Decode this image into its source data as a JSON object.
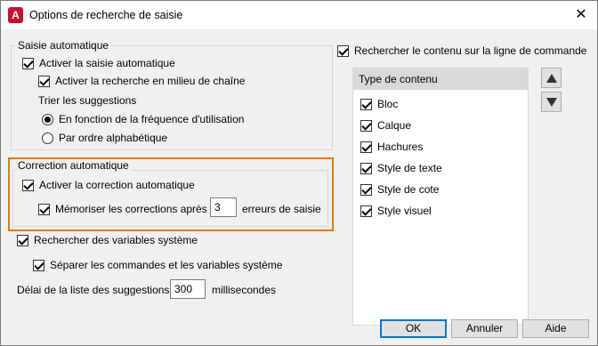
{
  "window": {
    "title": "Options de recherche de saisie",
    "app_icon_letter": "A",
    "close_glyph": "✕"
  },
  "autocomplete": {
    "group_title": "Saisie automatique",
    "enable_label": "Activer la saisie automatique",
    "enable_checked": true,
    "midstring_label": "Activer la recherche en milieu de chaîne",
    "midstring_checked": true,
    "sort_label": "Trier les suggestions",
    "sort_options": [
      {
        "label": "En fonction de la fréquence d'utilisation",
        "selected": true
      },
      {
        "label": "Par ordre alphabétique",
        "selected": false
      }
    ]
  },
  "autocorrect": {
    "group_title": "Correction automatique",
    "enable_label": "Activer la correction automatique",
    "enable_checked": true,
    "remember_label": "Mémoriser les corrections après",
    "remember_checked": true,
    "remember_value": "3",
    "remember_suffix": "erreurs de saisie",
    "highlight_color": "#e07b14"
  },
  "sysvars": {
    "search_label": "Rechercher des variables système",
    "search_checked": true,
    "separate_label": "Séparer les commandes et les variables système",
    "separate_checked": true
  },
  "delay": {
    "label": "Délai de la liste des suggestions",
    "value": "300",
    "suffix": "millisecondes"
  },
  "content_search": {
    "label": "Rechercher le contenu sur la ligne de commande",
    "checked": true,
    "list_header": "Type de contenu",
    "items": [
      {
        "label": "Bloc",
        "checked": true
      },
      {
        "label": "Calque",
        "checked": true
      },
      {
        "label": "Hachures",
        "checked": true
      },
      {
        "label": "Style de texte",
        "checked": true
      },
      {
        "label": "Style de cote",
        "checked": true
      },
      {
        "label": "Style visuel",
        "checked": true
      }
    ]
  },
  "buttons": {
    "ok": "OK",
    "cancel": "Annuler",
    "help": "Aide"
  }
}
